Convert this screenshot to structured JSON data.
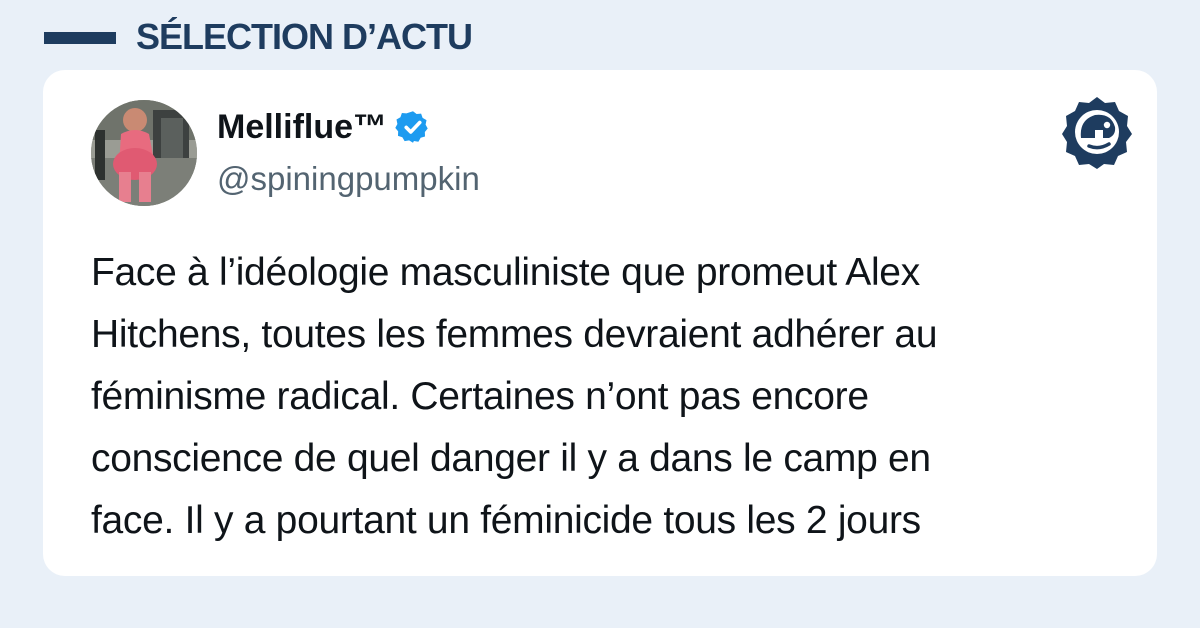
{
  "header": {
    "title": "SÉLECTION D’ACTU"
  },
  "tweet": {
    "display_name": "Melliflue™",
    "handle": "@spiningpumpkin",
    "verified": true,
    "text_lines": [
      "Face à l’idéologie masculiniste que promeut Alex",
      "Hitchens, toutes les femmes devraient adhérer au",
      "féminisme radical. Certaines n’ont pas encore",
      "conscience de quel danger il y a dans le camp en",
      "face. Il y a pourtant un féminicide tous les 2 jours"
    ]
  },
  "icons": {
    "verified": "verified-badge-icon",
    "brand": "brand-logo-icon"
  },
  "colors": {
    "accent": "#1e3c5f",
    "background": "#e9f0f8",
    "verified": "#1d9bf0"
  }
}
